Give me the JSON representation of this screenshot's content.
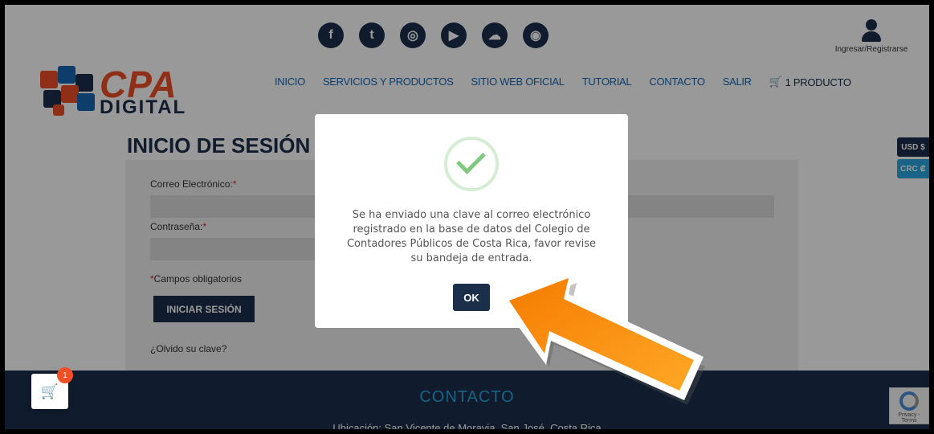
{
  "social": {
    "icons": [
      "facebook-icon",
      "twitter-icon",
      "instagram-icon",
      "youtube-icon",
      "soundcloud-icon",
      "vimeo-icon"
    ],
    "glyphs": [
      "f",
      "t",
      "◎",
      "▶",
      "☁",
      "◉"
    ]
  },
  "account": {
    "label": "Ingresar/Registrarse"
  },
  "logo": {
    "line1": "CPA",
    "line2": "DIGITAL"
  },
  "nav": {
    "items": [
      "INICIO",
      "SERVICIOS Y PRODUCTOS",
      "SITIO WEB OFICIAL",
      "TUTORIAL",
      "CONTACTO",
      "SALIR"
    ],
    "cart_label": "1 PRODUCTO"
  },
  "page": {
    "title": "INICIO DE SESIÓN",
    "email_label": "Correo Electrónico:",
    "password_label": "Contraseña:",
    "required_mark": "*",
    "required_note": "Campos obligatorios",
    "login_button": "INICIAR SESIÓN",
    "forgot": "¿Olvido su clave?"
  },
  "currency": {
    "usd": "USD $",
    "crc": "CRC ₡"
  },
  "footer": {
    "title": "CONTACTO",
    "line": "Ubicación: San Vicente de Moravia, San José, Costa Rica"
  },
  "float_cart": {
    "badge": "1"
  },
  "recaptcha": {
    "text": "Privacy - Terms"
  },
  "modal": {
    "message": "Se ha enviado una clave al correo electrónico registrado en la base de datos del Colegio de Contadores Públicos de Costa Rica, favor revise su bandeja de entrada.",
    "ok": "OK"
  },
  "colors": {
    "navy": "#1b2f4b",
    "link": "#1767b3",
    "orange": "#f04f28",
    "arrow": "#f7941d",
    "success": "#7dc97e"
  }
}
